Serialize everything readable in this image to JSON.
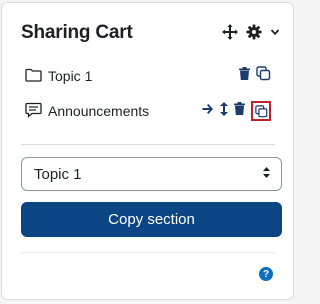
{
  "block": {
    "title": "Sharing Cart",
    "header_icons": [
      "move-icon",
      "gear-icon",
      "chevron-down-icon"
    ]
  },
  "items": [
    {
      "label": "Topic 1",
      "type_icon": "folder-icon",
      "actions": [
        "trash-icon",
        "copy-icon"
      ]
    },
    {
      "label": "Announcements",
      "type_icon": "forum-icon",
      "actions": [
        "arrow-right-icon",
        "move-vertical-icon",
        "trash-icon",
        "copy-icon"
      ],
      "highlighted_action": "copy-icon"
    }
  ],
  "section_select": {
    "value": "Topic 1"
  },
  "copy_button": {
    "label": "Copy section"
  },
  "help": {
    "icon": "question-circle-icon",
    "glyph": "?"
  },
  "colors": {
    "primary": "#0b4584",
    "icon": "#1d3b6e",
    "highlight": "#c0202d",
    "help": "#0f6cbf"
  }
}
